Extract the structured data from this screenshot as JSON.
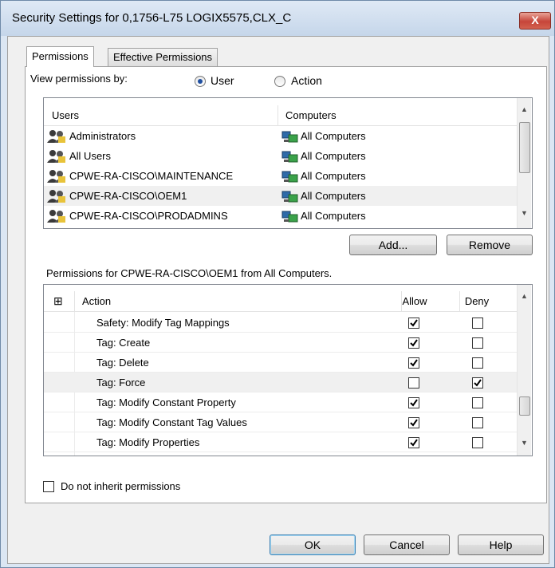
{
  "window": {
    "title": "Security Settings for 0,1756-L75 LOGIX5575,CLX_C",
    "close_label": "X"
  },
  "tabs": [
    {
      "label": "Permissions",
      "selected": true
    },
    {
      "label": "Effective Permissions",
      "selected": false
    }
  ],
  "view_by": {
    "label": "View permissions by:",
    "options": [
      {
        "label": "User",
        "selected": true
      },
      {
        "label": "Action",
        "selected": false
      }
    ]
  },
  "users_list": {
    "columns": [
      "Users",
      "Computers"
    ],
    "rows": [
      {
        "user": "Administrators",
        "computer": "All Computers",
        "icon": "user-group-icon",
        "selected": false
      },
      {
        "user": "All Users",
        "computer": "All Computers",
        "icon": "user-group-icon",
        "selected": false
      },
      {
        "user": "CPWE-RA-CISCO\\MAINTENANCE",
        "computer": "All Computers",
        "icon": "user-group-icon",
        "selected": false
      },
      {
        "user": "CPWE-RA-CISCO\\OEM1",
        "computer": "All Computers",
        "icon": "user-group-icon",
        "selected": true
      },
      {
        "user": "CPWE-RA-CISCO\\PRODADMINS",
        "computer": "All Computers",
        "icon": "user-group-icon",
        "selected": false
      }
    ]
  },
  "buttons": {
    "add": "Add...",
    "remove": "Remove",
    "ok": "OK",
    "cancel": "Cancel",
    "help": "Help"
  },
  "permissions": {
    "label": "Permissions for CPWE-RA-CISCO\\OEM1 from All Computers.",
    "expand_glyph": "⊞",
    "columns": {
      "action": "Action",
      "allow": "Allow",
      "deny": "Deny"
    },
    "rows": [
      {
        "action": "Safety: Modify Tag Mappings",
        "allow": true,
        "deny": false,
        "selected": false
      },
      {
        "action": "Tag: Create",
        "allow": true,
        "deny": false,
        "selected": false
      },
      {
        "action": "Tag: Delete",
        "allow": true,
        "deny": false,
        "selected": false
      },
      {
        "action": "Tag: Force",
        "allow": false,
        "deny": true,
        "selected": true
      },
      {
        "action": "Tag: Modify Constant Property",
        "allow": true,
        "deny": false,
        "selected": false
      },
      {
        "action": "Tag: Modify Constant Tag Values",
        "allow": true,
        "deny": false,
        "selected": false
      },
      {
        "action": "Tag: Modify Properties",
        "allow": true,
        "deny": false,
        "selected": false
      }
    ]
  },
  "inherit": {
    "label": "Do not inherit permissions",
    "checked": false
  },
  "colors": {
    "selected_row": "#f0f0f0",
    "title_bg": "#c5d6ea",
    "close_red": "#c6453a"
  }
}
